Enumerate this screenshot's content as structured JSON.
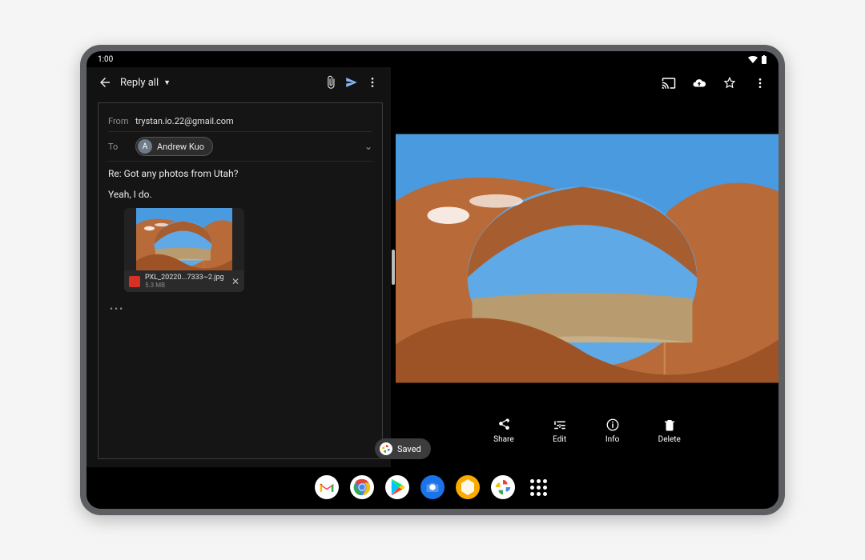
{
  "status": {
    "time": "1:00"
  },
  "gmail": {
    "reply_label": "Reply all",
    "from_label": "From",
    "from_value": "trystan.io.22@gmail.com",
    "to_label": "To",
    "recipient_initial": "A",
    "recipient_name": "Andrew Kuo",
    "subject": "Re: Got any photos from Utah?",
    "body": "Yeah, I do.",
    "attachment_name": "PXL_20220...7333~2.jpg",
    "attachment_size": "5.3 MB"
  },
  "photos": {
    "share": "Share",
    "edit": "Edit",
    "info": "Info",
    "delete": "Delete"
  },
  "toast": {
    "text": "Saved"
  },
  "shelf": {
    "gmail": "Gmail",
    "chrome": "Chrome",
    "play": "Play Store",
    "camera": "Camera",
    "files": "Files",
    "photos": "Photos",
    "apps": "All apps"
  }
}
